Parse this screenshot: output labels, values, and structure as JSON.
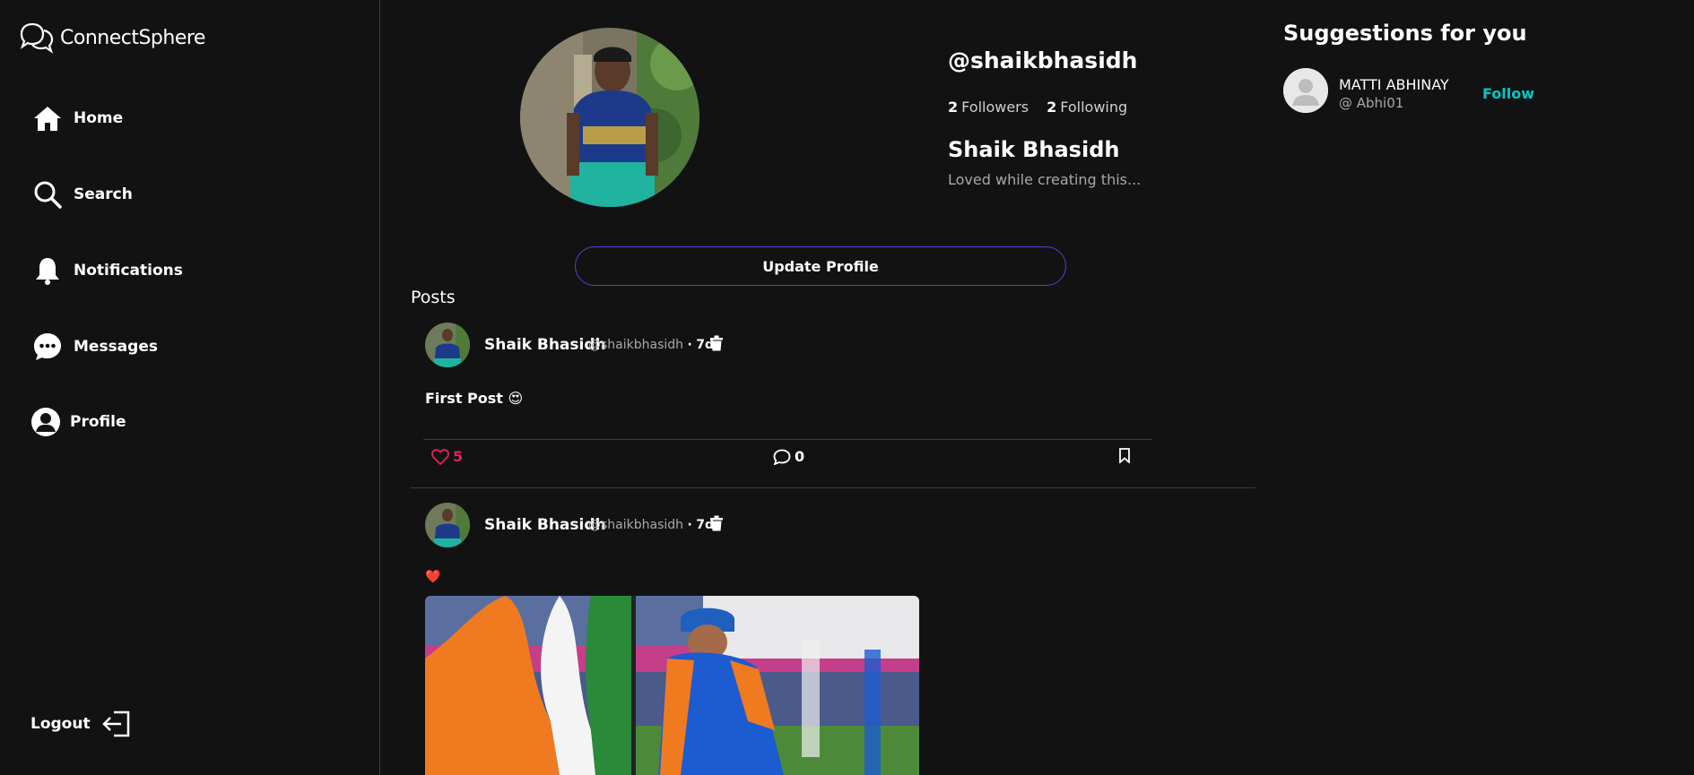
{
  "app": {
    "name": "ConnectSphere"
  },
  "sidebar": {
    "items": [
      {
        "label": "Home",
        "icon": "home-icon"
      },
      {
        "label": "Search",
        "icon": "search-icon"
      },
      {
        "label": "Notifications",
        "icon": "bell-icon"
      },
      {
        "label": "Messages",
        "icon": "chat-icon"
      },
      {
        "label": "Profile",
        "icon": "user-icon"
      }
    ],
    "logout_label": "Logout"
  },
  "profile": {
    "handle": "@shaikbhasidh",
    "followers_count": "2",
    "followers_label": "Followers",
    "following_count": "2",
    "following_label": "Following",
    "name": "Shaik Bhasidh",
    "bio": "Loved while creating this...",
    "update_button": "Update Profile",
    "posts_title": "Posts"
  },
  "posts": [
    {
      "author": "Shaik Bhasidh",
      "handle": "@shaikbhasidh",
      "time": "7d",
      "text": "First Post 😍",
      "likes": "5",
      "comments": "0"
    },
    {
      "author": "Shaik Bhasidh",
      "handle": "@shaikbhasidh",
      "time": "7d",
      "text": "❤️"
    }
  ],
  "suggestions": {
    "title": "Suggestions for you",
    "users": [
      {
        "name": "MATTI ABHINAY",
        "handle": "@ Abhi01",
        "follow_label": "Follow"
      }
    ]
  },
  "colors": {
    "background": "#121212",
    "accent_border": "#5b3fd6",
    "like": "#e0245e",
    "follow": "#00c8c8"
  }
}
